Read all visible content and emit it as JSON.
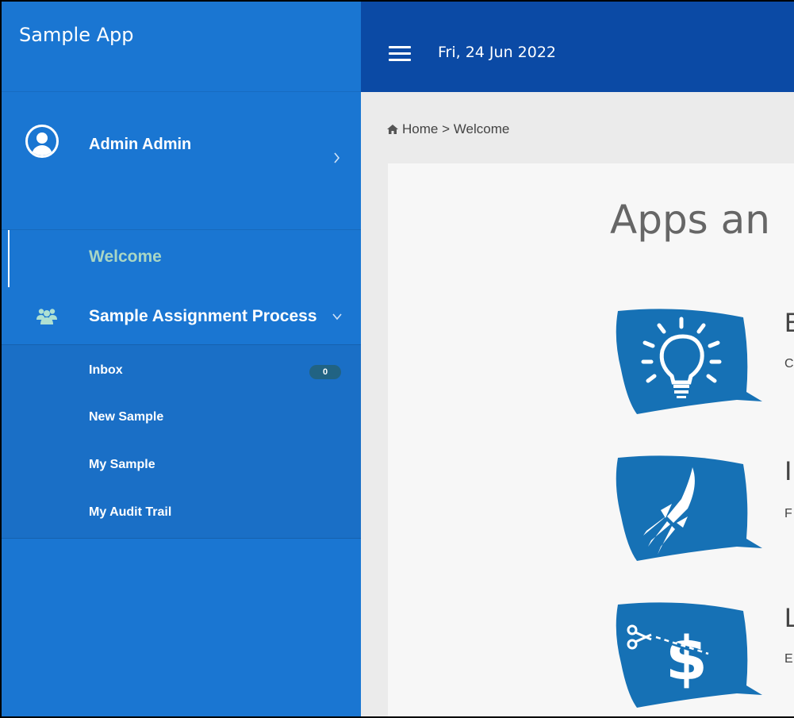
{
  "app": {
    "title": "Sample App"
  },
  "topbar": {
    "date": "Fri, 24 Jun 2022"
  },
  "user": {
    "name": "Admin Admin"
  },
  "sidebar": {
    "welcome_label": "Welcome",
    "process": {
      "label": "Sample Assignment Process",
      "items": [
        {
          "label": "Inbox",
          "badge": "0"
        },
        {
          "label": "New Sample"
        },
        {
          "label": "My Sample"
        },
        {
          "label": "My Audit Trail"
        }
      ]
    }
  },
  "breadcrumb": {
    "home": "Home",
    "separator": ">",
    "current": "Welcome"
  },
  "main": {
    "title": "Apps an",
    "features": [
      {
        "icon": "lightbulb-icon",
        "title": "E",
        "desc": "C"
      },
      {
        "icon": "rocket-icon",
        "title": "I",
        "desc": "F"
      },
      {
        "icon": "dollar-scissors-icon",
        "title": "L",
        "desc": "E"
      }
    ]
  },
  "colors": {
    "sidebar": "#1a76d2",
    "topbar": "#0b4aa5",
    "content_bg": "#ebebeb",
    "icon_blue": "#1671b5",
    "welcome_text": "#a9d6c4",
    "badge": "#216383"
  }
}
